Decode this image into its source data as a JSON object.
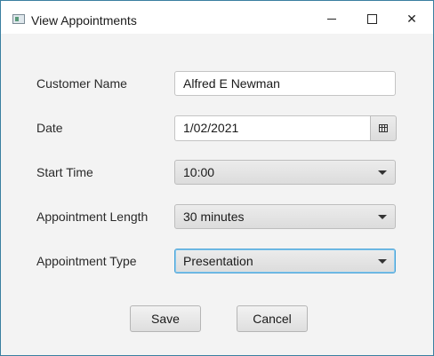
{
  "window": {
    "title": "View Appointments"
  },
  "form": {
    "customer_name": {
      "label": "Customer Name",
      "value": "Alfred E Newman"
    },
    "date": {
      "label": "Date",
      "value": "1/02/2021"
    },
    "start_time": {
      "label": "Start Time",
      "value": "10:00"
    },
    "length": {
      "label": "Appointment Length",
      "value": "30 minutes"
    },
    "type": {
      "label": "Appointment Type",
      "value": "Presentation"
    }
  },
  "buttons": {
    "save": "Save",
    "cancel": "Cancel"
  },
  "icons": {
    "app": "window-app-icon",
    "minimize": "minimize-icon",
    "maximize": "maximize-icon",
    "close": "close-icon",
    "calendar": "calendar-icon",
    "dropdown": "chevron-down-icon"
  },
  "colors": {
    "focus_border": "#4aa3d6",
    "window_background": "#f3f3f3"
  }
}
